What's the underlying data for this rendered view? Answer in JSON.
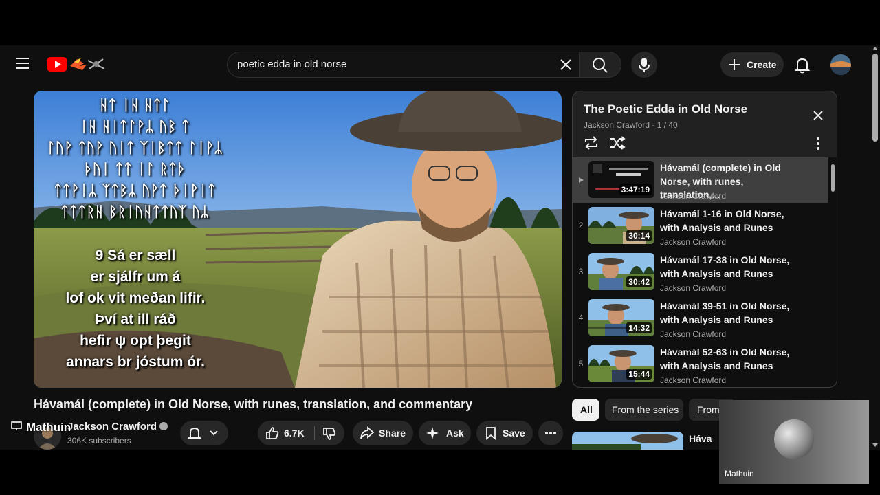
{
  "header": {
    "search_value": "poetic edda in old norse",
    "create_label": "Create"
  },
  "video": {
    "title": "Hávamál (complete) in Old Norse, with runes, translation, and commentary",
    "channel": "Jackson Crawford",
    "subscribers": "306K subscribers",
    "likes": "6.7K",
    "share_label": "Share",
    "ask_label": "Ask",
    "save_label": "Save",
    "runes": [
      "ᚺᛏ ᛁᚺ ᚺᛏᛚ",
      "ᛁᚺ ᚺᛁᛏᛚᚹᛦ ᚢᛒ ᛏ",
      "ᛚᚢᚹ ᛏᚢᚹ ᚢᛁᛏ ᛉᛁᛒᛏᛏ ᛚᛁᚹᛦ",
      "ᚦᚢᛁ ᛏᛏ ᛁᛚ ᚱᛏᚦ",
      "ᛏᛏᚹᛁᛦ ᛉᛏᛒᛦ ᚢᚹᛏ ᚦᛁᚹᛁᛏ",
      "ᛏᛏᛏᚱᚺ ᛒᚱᛁᚢᚺᛏᛏᚢᛉ ᚢᛦ"
    ],
    "verse": [
      "9 Sá er sæll",
      "er sjálfr um á",
      "lof ok vit meðan lifir.",
      "Því at ill ráð",
      "hefir ψ opt þegit",
      "annars br jóstum ór."
    ]
  },
  "playlist": {
    "title": "The Poetic Edda in Old Norse",
    "subtitle": "Jackson Crawford - 1 / 40",
    "items": [
      {
        "index": "",
        "title": "Hávamál (complete) in Old Norse, with runes, translation,...",
        "channel": "Jackson Crawford",
        "duration": "3:47:19",
        "active": true
      },
      {
        "index": "2",
        "title": "Hávamál 1-16 in Old Norse, with Analysis and Runes",
        "channel": "Jackson Crawford",
        "duration": "30:14"
      },
      {
        "index": "3",
        "title": "Hávamál 17-38 in Old Norse, with Analysis and Runes",
        "channel": "Jackson Crawford",
        "duration": "30:42"
      },
      {
        "index": "4",
        "title": "Hávamál 39-51 in Old Norse, with Analysis and Runes",
        "channel": "Jackson Crawford",
        "duration": "14:32"
      },
      {
        "index": "5",
        "title": "Hávamál 52-63 in Old Norse, with Analysis and Runes",
        "channel": "Jackson Crawford",
        "duration": "15:44"
      }
    ]
  },
  "chips": [
    "All",
    "From the series",
    "From"
  ],
  "recommendation": {
    "title": "Háva"
  },
  "overlay": {
    "name": "Mathuin"
  },
  "pip": {
    "name": "Mathuin"
  }
}
